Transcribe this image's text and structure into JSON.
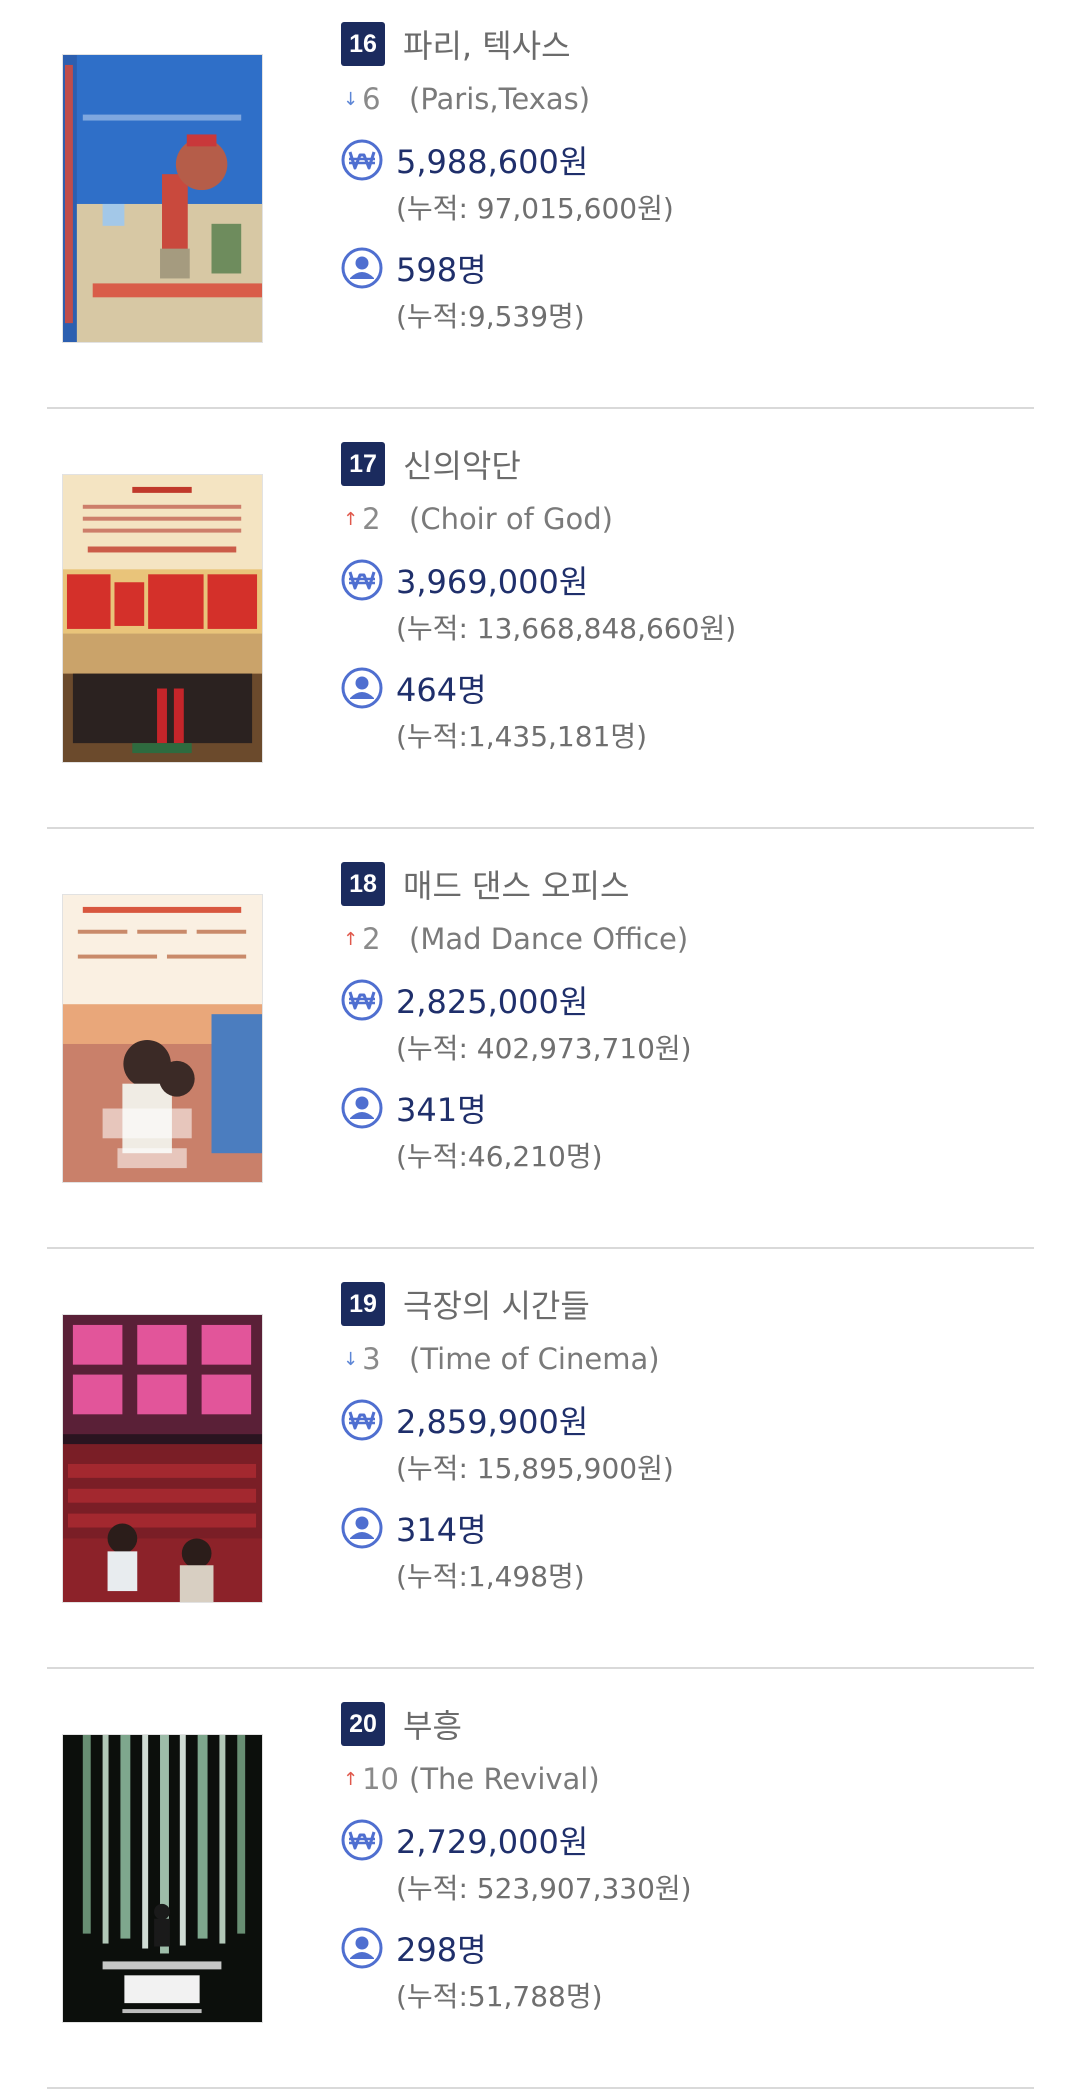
{
  "entries": [
    {
      "rank": "16",
      "title": "파리, 텍사스",
      "change_dir": "down",
      "change_value": "6",
      "english_title": "(Paris,Texas)",
      "sales": "5,988,600원",
      "sales_cumulative": "(누적: 97,015,600원)",
      "audience": "598명",
      "audience_cumulative": "(누적:9,539명)"
    },
    {
      "rank": "17",
      "title": "신의악단",
      "change_dir": "up",
      "change_value": "2",
      "english_title": "(Choir of God)",
      "sales": "3,969,000원",
      "sales_cumulative": "(누적: 13,668,848,660원)",
      "audience": "464명",
      "audience_cumulative": "(누적:1,435,181명)"
    },
    {
      "rank": "18",
      "title": "매드 댄스 오피스",
      "change_dir": "up",
      "change_value": "2",
      "english_title": "(Mad Dance Office)",
      "sales": "2,825,000원",
      "sales_cumulative": "(누적: 402,973,710원)",
      "audience": "341명",
      "audience_cumulative": "(누적:46,210명)"
    },
    {
      "rank": "19",
      "title": "극장의 시간들",
      "change_dir": "down",
      "change_value": "3",
      "english_title": "(Time of Cinema)",
      "sales": "2,859,900원",
      "sales_cumulative": "(누적: 15,895,900원)",
      "audience": "314명",
      "audience_cumulative": "(누적:1,498명)"
    },
    {
      "rank": "20",
      "title": "부흥",
      "change_dir": "up",
      "change_value": "10",
      "english_title": "(The Revival)",
      "sales": "2,729,000원",
      "sales_cumulative": "(누적: 523,907,330원)",
      "audience": "298명",
      "audience_cumulative": "(누적:51,788명)"
    }
  ],
  "icons": {
    "down_arrow": "↓",
    "up_arrow": "↑",
    "won_glyph": "₩"
  },
  "colors": {
    "badge": "#1b2b5e",
    "stat_value": "#1f2f6b",
    "icon_blue": "#4f6fd0",
    "arrow_down": "#5d86d6",
    "arrow_up": "#e0584b"
  }
}
